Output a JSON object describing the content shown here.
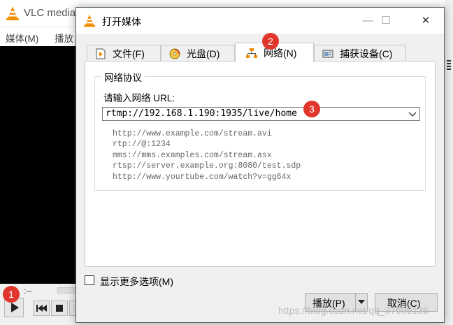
{
  "vlc": {
    "title": "VLC media",
    "menu": [
      "媒体(M)",
      "播放"
    ],
    "time_left": ":--"
  },
  "dialog": {
    "title": "打开媒体",
    "controls": {
      "minimize": "—",
      "maximize": "☐",
      "close": "✕"
    },
    "tabs": [
      {
        "label": "文件(F)",
        "icon": "file-play-icon"
      },
      {
        "label": "光盘(D)",
        "icon": "disc-icon"
      },
      {
        "label": "网络(N)",
        "icon": "network-icon",
        "active": true
      },
      {
        "label": "捕获设备(C)",
        "icon": "capture-device-icon"
      }
    ],
    "network": {
      "group_title": "网络协议",
      "url_label": "请输入网络 URL:",
      "url_value": "rtmp://192.168.1.190:1935/live/home",
      "examples": [
        "http://www.example.com/stream.avi",
        "rtp://@:1234",
        "mms://mms.examples.com/stream.asx",
        "rtsp://server.example.org:8080/test.sdp",
        "http://www.yourtube.com/watch?v=gg64x"
      ]
    },
    "more_options_label": "显示更多选项(M)",
    "more_options_checked": false,
    "play_button": "播放(P)",
    "cancel_button": "取消(C)"
  },
  "annotations": [
    "1",
    "2",
    "3"
  ],
  "watermark": "https://blog.csdn.net/qq_37609136",
  "colors": {
    "badge": "#e0362c",
    "vlc_orange": "#f28c00"
  }
}
